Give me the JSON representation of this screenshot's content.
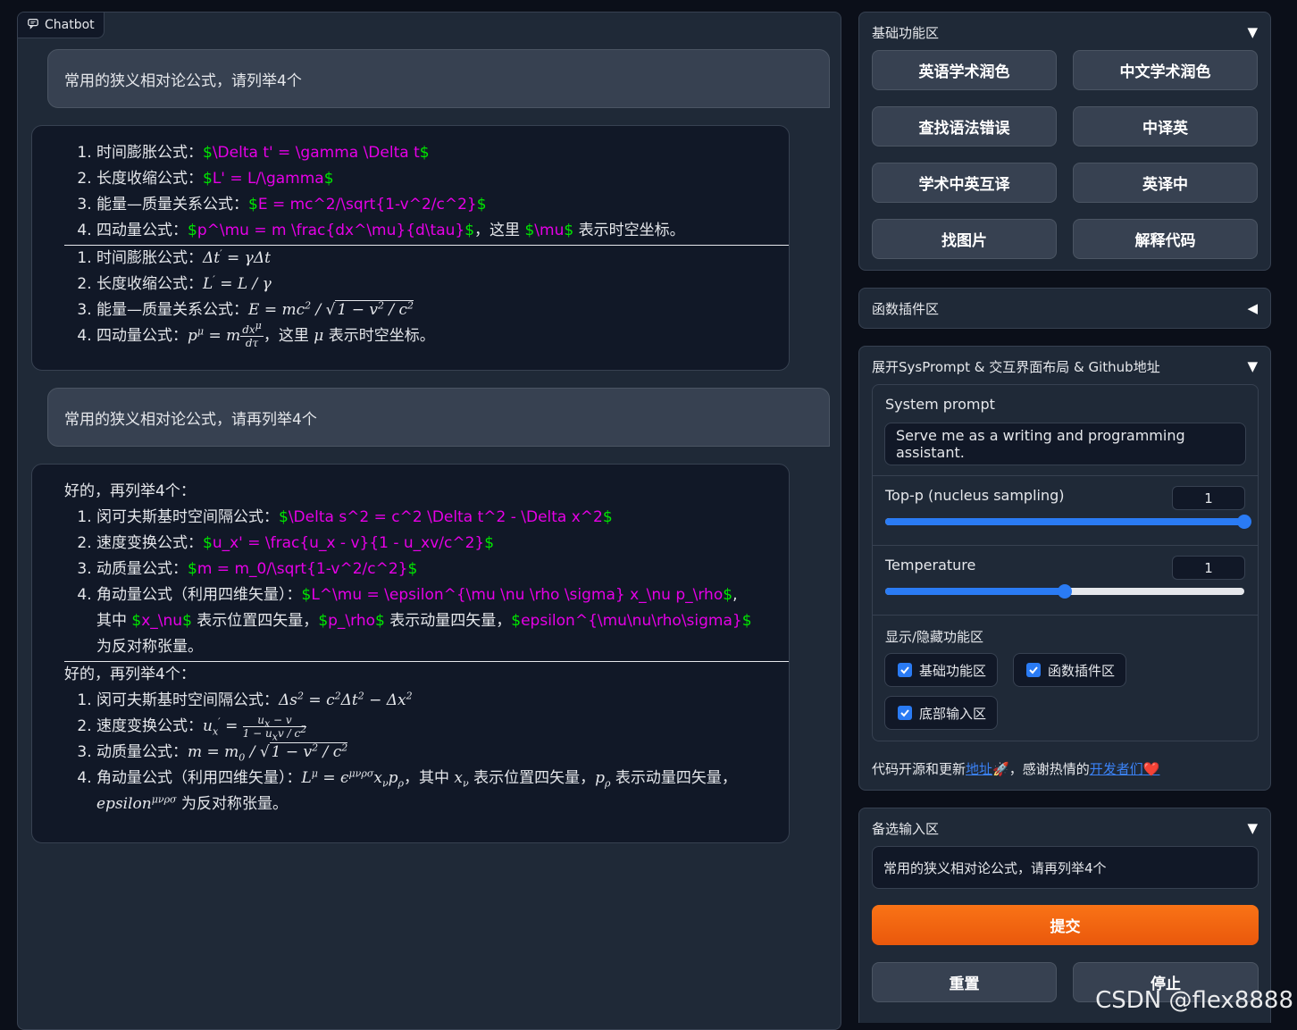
{
  "chatbot": {
    "label": "Chatbot",
    "messages": [
      {
        "role": "user",
        "text": "常用的狭义相对论公式，请列举4个"
      },
      {
        "role": "bot",
        "raw_items": [
          {
            "prefix": "时间膨胀公式：",
            "latex": "$\\Delta t' = \\gamma \\Delta t$",
            "suffix": ""
          },
          {
            "prefix": "长度收缩公式：",
            "latex": "$L' = L/\\gamma$",
            "suffix": ""
          },
          {
            "prefix": "能量—质量关系公式：",
            "latex": "$E = mc^2/\\sqrt{1-v^2/c^2}$",
            "suffix": ""
          },
          {
            "prefix": "四动量公式：",
            "latex": "$p^\\mu = m \\frac{dx^\\mu}{d\\tau}$",
            "mid": "，这里 ",
            "latex2": "$\\mu$",
            "suffix": " 表示时空坐标。"
          }
        ],
        "rendered_labels": [
          "时间膨胀公式：",
          "长度收缩公式：",
          "能量—质量关系公式：",
          "四动量公式："
        ],
        "rendered_tail": "，这里 μ 表示时空坐标。"
      },
      {
        "role": "user",
        "text": "常用的狭义相对论公式，请再列举4个"
      },
      {
        "role": "bot",
        "intro": "好的，再列举4个：",
        "raw_items": [
          {
            "prefix": "闵可夫斯基时空间隔公式：",
            "latex": "$\\Delta s^2 = c^2 \\Delta t^2 - \\Delta x^2$"
          },
          {
            "prefix": "速度变换公式：",
            "latex": "$u_x' = \\frac{u_x - v}{1 - u_xv/c^2}$"
          },
          {
            "prefix": "动质量公式：",
            "latex": "$m = m_0/\\sqrt{1-v^2/c^2}$"
          },
          {
            "prefix": "角动量公式（利用四维矢量）：",
            "latex": "$L^\\mu = \\epsilon^{\\mu \\nu \\rho \\sigma} x_\\nu p_\\rho$",
            "mid1": "，其中 ",
            "latex_x": "$x_\\nu$",
            "mid2": " 表示位置四矢量，",
            "latex_p": "$p_\\rho$",
            "mid3": " 表示动量四矢量，",
            "latex_e": "$epsilon^{\\mu\\nu\\rho\\sigma}$",
            "suffix": " 为反对称张量。"
          }
        ],
        "rendered_labels": [
          "闵可夫斯基时空间隔公式：",
          "速度变换公式：",
          "动质量公式：",
          "角动量公式（利用四维矢量）："
        ],
        "rendered_mid1": "，其中 ",
        "rendered_mid2": " 表示位置四矢量，",
        "rendered_mid3": " 表示动量四矢量，",
        "rendered_suffix": " 为反对称张量。"
      }
    ]
  },
  "basic_panel": {
    "title": "基础功能区",
    "toggle": "▼",
    "buttons": [
      "英语学术润色",
      "中文学术润色",
      "查找语法错误",
      "中译英",
      "学术中英互译",
      "英译中",
      "找图片",
      "解释代码"
    ]
  },
  "plugin_panel": {
    "title": "函数插件区",
    "toggle": "◀"
  },
  "sys_panel": {
    "title": "展开SysPrompt & 交互界面布局 & Github地址",
    "toggle": "▼",
    "system_prompt_label": "System prompt",
    "system_prompt_value": "Serve me as a writing and programming assistant.",
    "top_p_label": "Top-p (nucleus sampling)",
    "top_p_value": "1",
    "top_p_fraction": 1.0,
    "temperature_label": "Temperature",
    "temperature_value": "1",
    "temperature_fraction": 0.5,
    "visibility_label": "显示/隐藏功能区",
    "checkboxes": [
      "基础功能区",
      "函数插件区",
      "底部输入区"
    ],
    "footer_prefix": "代码开源和更新",
    "footer_link1": "地址",
    "footer_rocket": "🚀",
    "footer_mid": "，感谢热情的",
    "footer_link2": "开发者们",
    "footer_heart": "❤️"
  },
  "input_panel": {
    "title": "备选输入区",
    "toggle": "▼",
    "input_value": "常用的狭义相对论公式，请再列举4个",
    "submit_label": "提交",
    "reset_label": "重置",
    "stop_label": "停止"
  },
  "watermark": "CSDN @flex8888",
  "colors": {
    "accent": "#2a7bf4",
    "submit": "#f97316",
    "latex_green": "#00e600",
    "latex_magenta": "#e600e6"
  }
}
